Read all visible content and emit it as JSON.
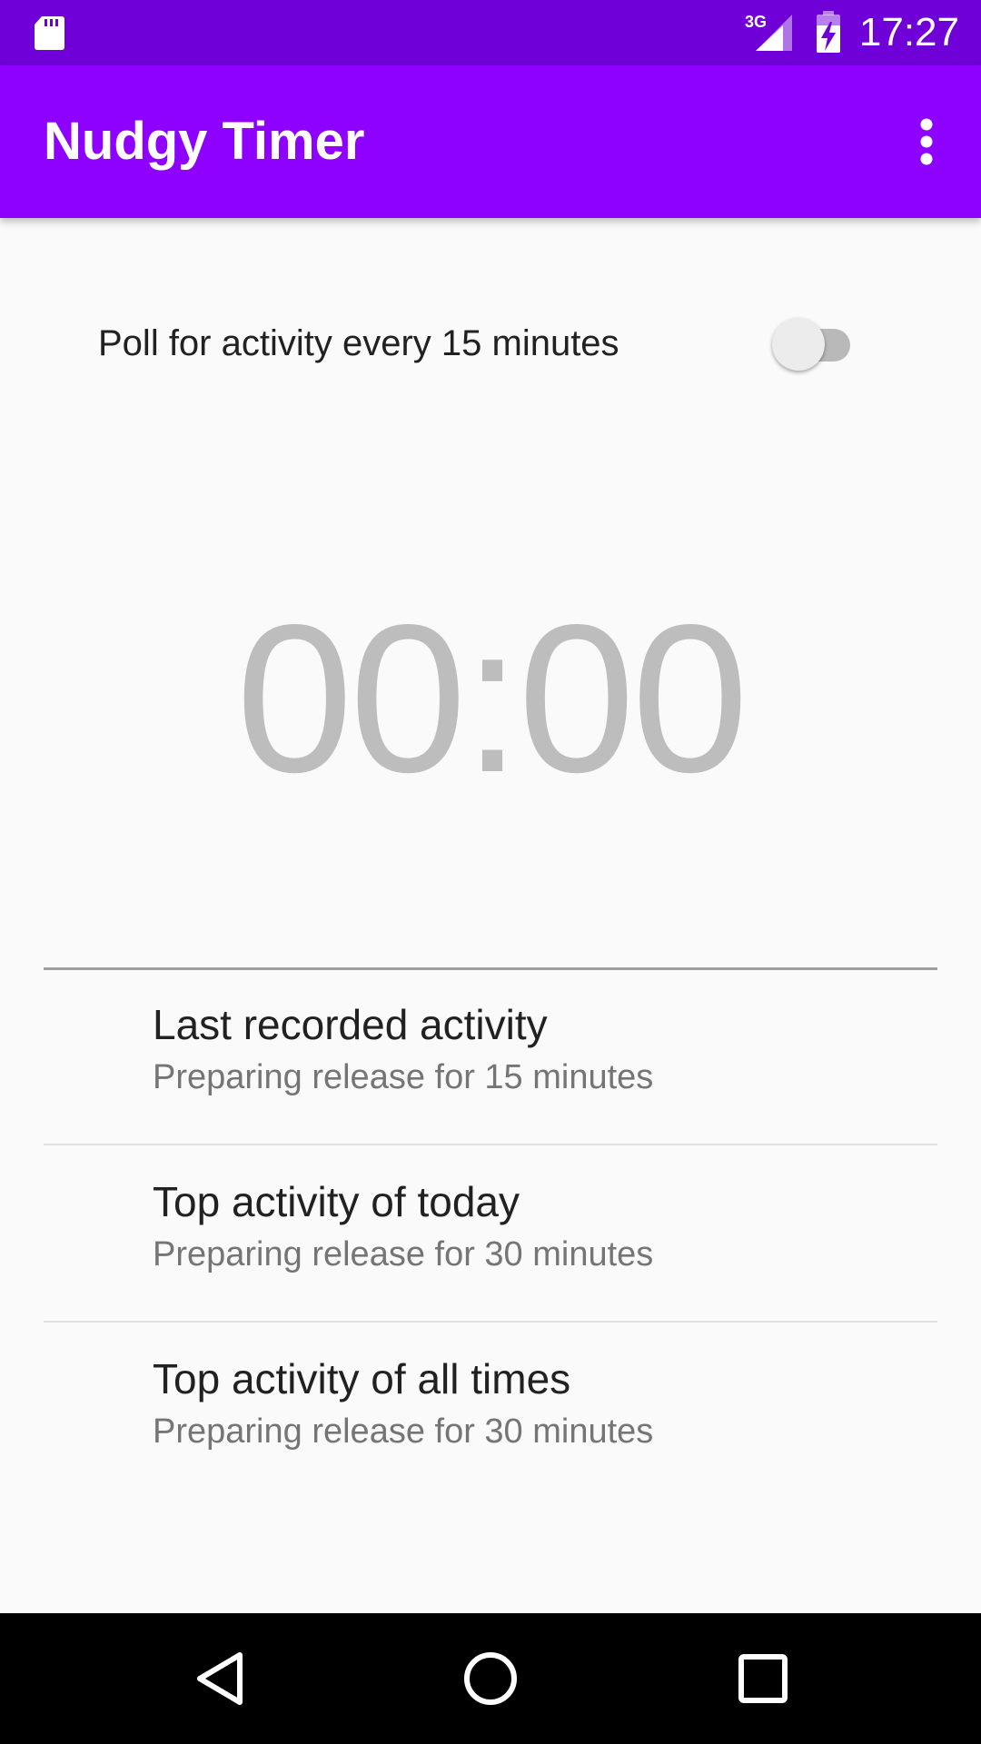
{
  "status_bar": {
    "time": "17:27",
    "network_label": "3G",
    "icons": [
      "sd-card-icon",
      "signal-icon",
      "battery-charging-icon"
    ]
  },
  "app_bar": {
    "title": "Nudgy Timer",
    "menu_icon": "overflow-menu-icon"
  },
  "poll": {
    "label": "Poll for activity every 15 minutes",
    "enabled": false
  },
  "timer": {
    "display": "00:00"
  },
  "activities": [
    {
      "title": "Last recorded activity",
      "subtitle": "Preparing release for 15 minutes"
    },
    {
      "title": "Top activity of today",
      "subtitle": "Preparing release for 30 minutes"
    },
    {
      "title": "Top activity of all times",
      "subtitle": "Preparing release for 30 minutes"
    }
  ],
  "nav_bar": {
    "icons": [
      "back-icon",
      "home-icon",
      "recents-icon"
    ]
  },
  "colors": {
    "status_bar": "#7000d8",
    "app_bar": "#8e00ff",
    "background": "#fafafa",
    "timer_text": "#bdbdbd"
  }
}
